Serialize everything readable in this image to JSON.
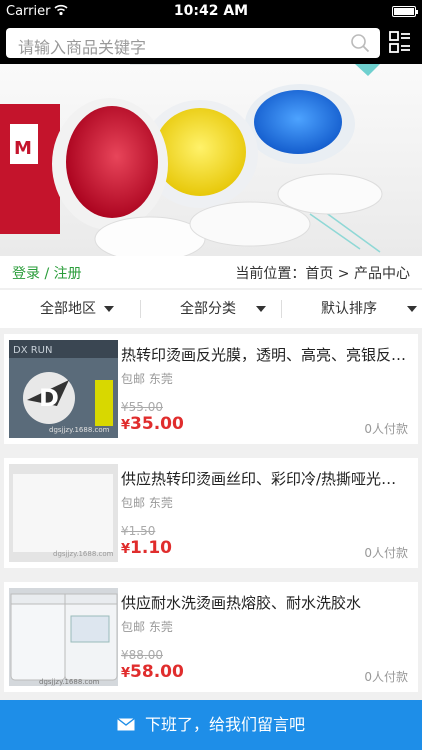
{
  "status_bar": {
    "carrier": "Carrier",
    "time": "10:42 AM"
  },
  "search": {
    "placeholder": "请输入商品关键字"
  },
  "header": {
    "login": "登录 / 注册",
    "breadcrumb": "当前位置：首页 > 产品中心"
  },
  "filters": [
    {
      "label": "全部地区"
    },
    {
      "label": "全部分类"
    },
    {
      "label": "默认排序"
    }
  ],
  "products": [
    {
      "title": "热转印烫画反光膜，透明、高亮、亮银反光膜",
      "shipping": "包邮 东莞",
      "old_price": "¥55.00",
      "price_symbol": "¥",
      "price": "35.00",
      "sold": "0人付款",
      "thumb_text": "dgsjjzy.1688.com"
    },
    {
      "title": "供应热转印烫画丝印、彩印冷/热撕哑光离型膜",
      "shipping": "包邮 东莞",
      "old_price": "¥1.50",
      "price_symbol": "¥",
      "price": "1.10",
      "sold": "0人付款",
      "thumb_text": "dgsjjzy.1688.com"
    },
    {
      "title": "供应耐水洗烫画热熔胶、耐水洗胶水",
      "shipping": "包邮 东莞",
      "old_price": "¥88.00",
      "price_symbol": "¥",
      "price": "58.00",
      "sold": "0人付款",
      "thumb_text": "dgsjjzy.1688.com"
    }
  ],
  "footer": {
    "message_label": "下班了，给我们留言吧"
  }
}
